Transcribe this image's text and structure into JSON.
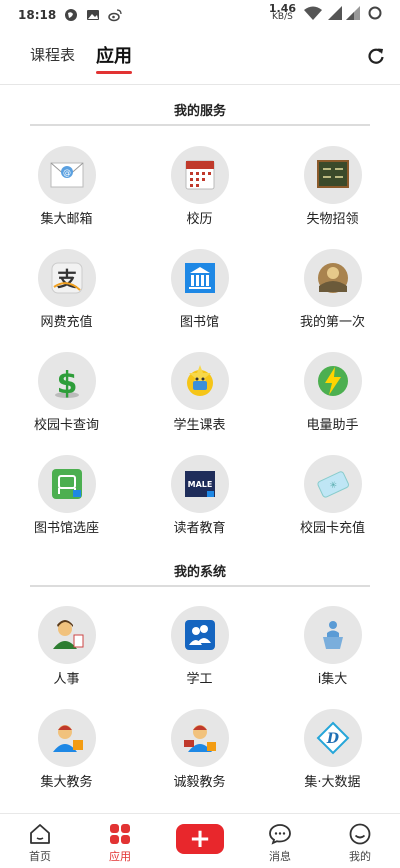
{
  "status": {
    "time": "18:18",
    "speed_value": "1.46",
    "speed_unit": "KB/S"
  },
  "header": {
    "tab_schedule": "课程表",
    "tab_apps": "应用"
  },
  "services": {
    "title": "我的服务",
    "items": [
      {
        "label": "集大邮箱",
        "icon": "mail-icon"
      },
      {
        "label": "校历",
        "icon": "calendar-icon"
      },
      {
        "label": "失物招领",
        "icon": "lost-found-board-icon"
      },
      {
        "label": "网费充值",
        "icon": "alipay-icon"
      },
      {
        "label": "图书馆",
        "icon": "library-building-icon"
      },
      {
        "label": "我的第一次",
        "icon": "first-time-photo-icon"
      },
      {
        "label": "校园卡查询",
        "icon": "dollar-icon"
      },
      {
        "label": "学生课表",
        "icon": "star-face-icon"
      },
      {
        "label": "电量助手",
        "icon": "lightning-icon"
      },
      {
        "label": "图书馆选座",
        "icon": "seat-select-icon"
      },
      {
        "label": "读者教育",
        "icon": "reader-education-icon"
      },
      {
        "label": "校园卡充值",
        "icon": "card-recharge-icon"
      }
    ]
  },
  "systems": {
    "title": "我的系统",
    "items": [
      {
        "label": "人事",
        "icon": "personnel-icon"
      },
      {
        "label": "学工",
        "icon": "student-affairs-icon"
      },
      {
        "label": "i集大",
        "icon": "podium-icon"
      },
      {
        "label": "集大教务",
        "icon": "academic-affairs-icon"
      },
      {
        "label": "诚毅教务",
        "icon": "chengyi-academic-icon"
      },
      {
        "label": "集·大数据",
        "icon": "big-data-icon"
      }
    ]
  },
  "colors": {
    "accent": "#e23333"
  },
  "nav": {
    "home": "首页",
    "apps": "应用",
    "add": "+",
    "messages": "消息",
    "me": "我的"
  }
}
